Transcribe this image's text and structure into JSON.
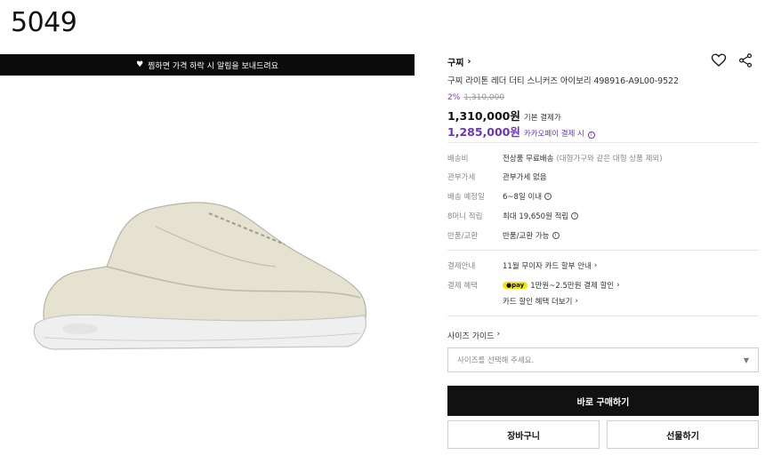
{
  "page_number": "5049",
  "banner": {
    "text": "찜하면 가격 하락 시 알림을 보내드려요"
  },
  "product": {
    "brand": "구찌",
    "title": "구찌 라이톤 레더 더티 스니커즈 아이보리 498916-A9L00-9522",
    "discount_pct": "2%",
    "original_price": "1,310,000",
    "price": "1,310,000원",
    "price_note": "기본 결제가",
    "kakao_price": "1,285,000원",
    "kakao_note": "카카오페이 결제 시"
  },
  "info_rows": [
    {
      "label": "배송비",
      "value": "전상품 무료배송",
      "extra": "(대형가구와 같은 대형 상품 제외)"
    },
    {
      "label": "관부가세",
      "value": "관부가세 없음",
      "extra": ""
    },
    {
      "label": "배송 예정일",
      "value": "6~8일 이내",
      "extra": ""
    },
    {
      "label": "8머니 적립",
      "value": "최대 19,650원 적립",
      "extra": ""
    },
    {
      "label": "반품/교환",
      "value": "반품/교환 가능",
      "extra": ""
    }
  ],
  "payment": {
    "guide_label": "결제안내",
    "guide_value": "11월 무이자 카드 할부 안내",
    "benefit_label": "결제 혜택",
    "pay_badge": "●pay",
    "benefit_value": "1만원~2.5만원 결제 할인",
    "card_link": "카드 할인 혜택 더보기"
  },
  "size": {
    "guide": "사이즈 가이드",
    "placeholder": "사이즈를 선택해 주세요."
  },
  "buttons": {
    "buy": "바로 구매하기",
    "cart": "장바구니",
    "gift": "선물하기"
  },
  "icons": {
    "heart": "heart-icon",
    "share": "share-icon"
  },
  "colors": {
    "accent_purple": "#6b35b8",
    "kakao_yellow": "#f7e600",
    "dark": "#111111"
  }
}
